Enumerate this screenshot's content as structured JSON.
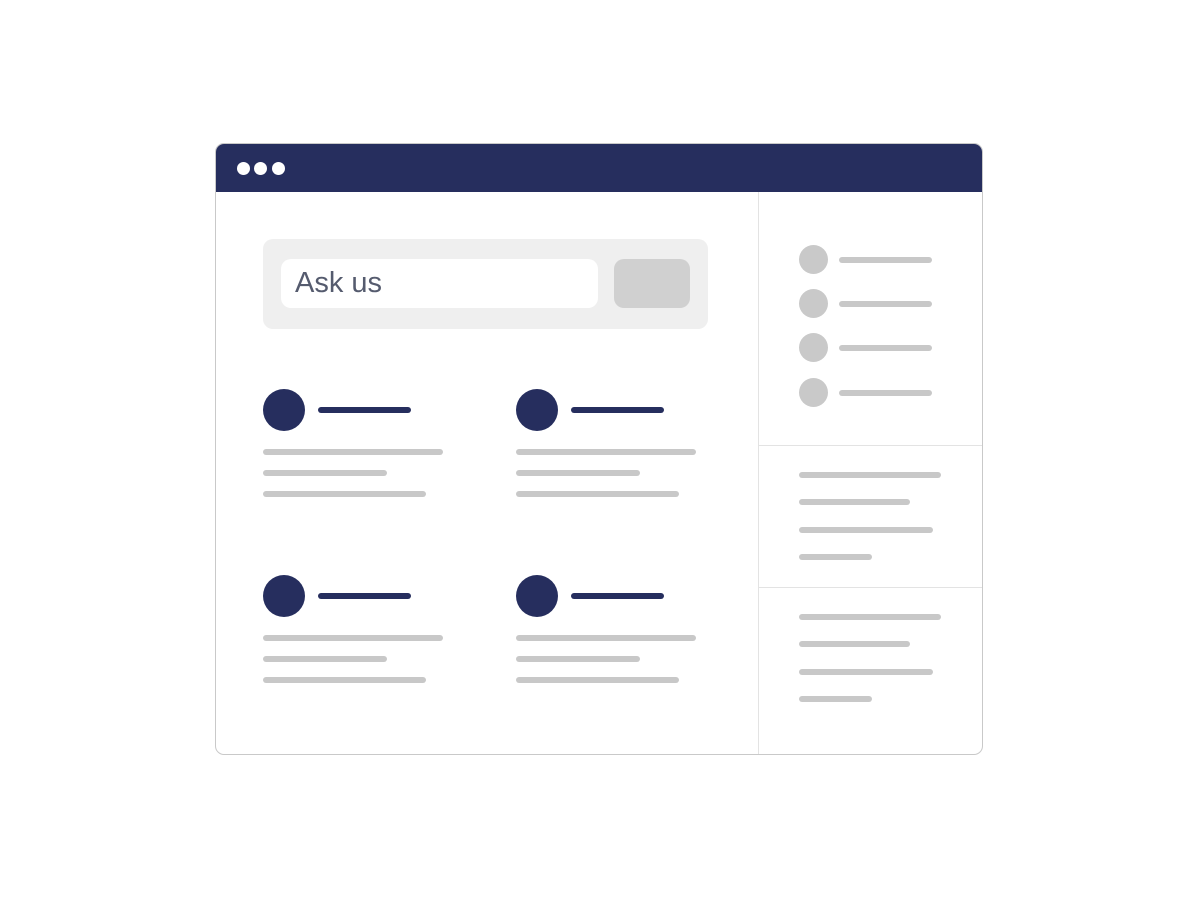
{
  "window": {
    "titlebar_color": "#262e5e",
    "window_controls": [
      "window-dot",
      "window-dot",
      "window-dot"
    ]
  },
  "search": {
    "placeholder": "Ask us",
    "button_icon": "blank-button"
  },
  "colors": {
    "accent": "#262e5e",
    "placeholder_gray": "#c8c8c8",
    "panel_gray": "#efefef",
    "button_gray": "#d0d0d0"
  },
  "cards": [
    {
      "avatar": "avatar-placeholder",
      "title": "",
      "lines": [
        "",
        "",
        ""
      ]
    },
    {
      "avatar": "avatar-placeholder",
      "title": "",
      "lines": [
        "",
        "",
        ""
      ]
    },
    {
      "avatar": "avatar-placeholder",
      "title": "",
      "lines": [
        "",
        "",
        ""
      ]
    },
    {
      "avatar": "avatar-placeholder",
      "title": "",
      "lines": [
        "",
        "",
        ""
      ]
    }
  ],
  "sidebar": {
    "list_items": [
      {
        "avatar": "avatar-placeholder",
        "label": ""
      },
      {
        "avatar": "avatar-placeholder",
        "label": ""
      },
      {
        "avatar": "avatar-placeholder",
        "label": ""
      },
      {
        "avatar": "avatar-placeholder",
        "label": ""
      }
    ],
    "text_blocks": [
      {
        "lines": [
          "",
          "",
          "",
          ""
        ]
      },
      {
        "lines": [
          "",
          "",
          "",
          ""
        ]
      }
    ]
  }
}
